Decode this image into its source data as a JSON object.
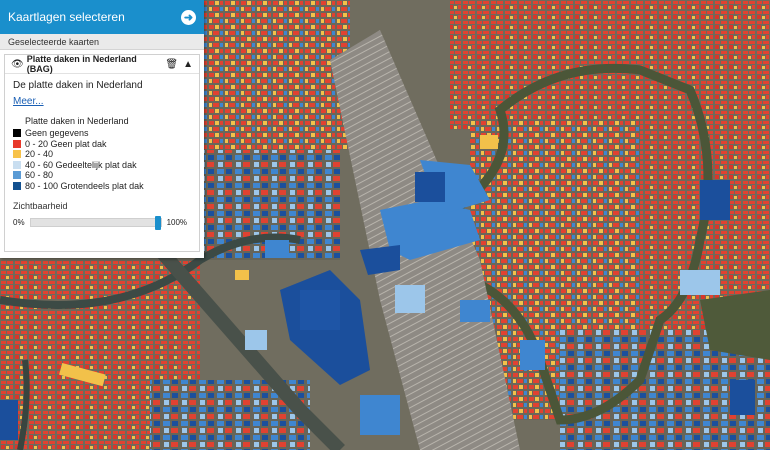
{
  "panel": {
    "title": "Kaartlagen selecteren",
    "go_icon": "arrow-right-circle-icon",
    "section_label": "Geselecteerde kaarten"
  },
  "layer": {
    "name": "Platte daken in Nederland (BAG)",
    "description": "De platte daken in Nederland",
    "more_link": "Meer...",
    "legend_title": "Platte daken in Nederland",
    "legend": [
      {
        "label": "Geen gegevens",
        "color": "#000000"
      },
      {
        "label": "0 - 20 Geen plat dak",
        "color": "#e8392b"
      },
      {
        "label": "20 - 40",
        "color": "#f7c24a"
      },
      {
        "label": "40 - 60 Gedeeltelijk plat dak",
        "color": "#c9def0"
      },
      {
        "label": "60 - 80",
        "color": "#5b9bd5"
      },
      {
        "label": "80 - 100 Grotendeels plat dak",
        "color": "#12508f"
      }
    ],
    "opacity_label": "Zichtbaarheid",
    "opacity_min": "0%",
    "opacity_max": "100%",
    "opacity_value": 1.0
  },
  "map": {
    "type": "aerial-orthophoto-with-roof-classification",
    "area_colors": {
      "ground": "#7a7868",
      "vegetation": "#4f5a3a",
      "water": "#3c4a45",
      "rail": "#8e8a84",
      "roof_red": "#e04231",
      "roof_yellow": "#f2c14a",
      "roof_light": "#9cc6ea",
      "roof_mid": "#3f86d0",
      "roof_dark": "#1b4f9c"
    }
  }
}
